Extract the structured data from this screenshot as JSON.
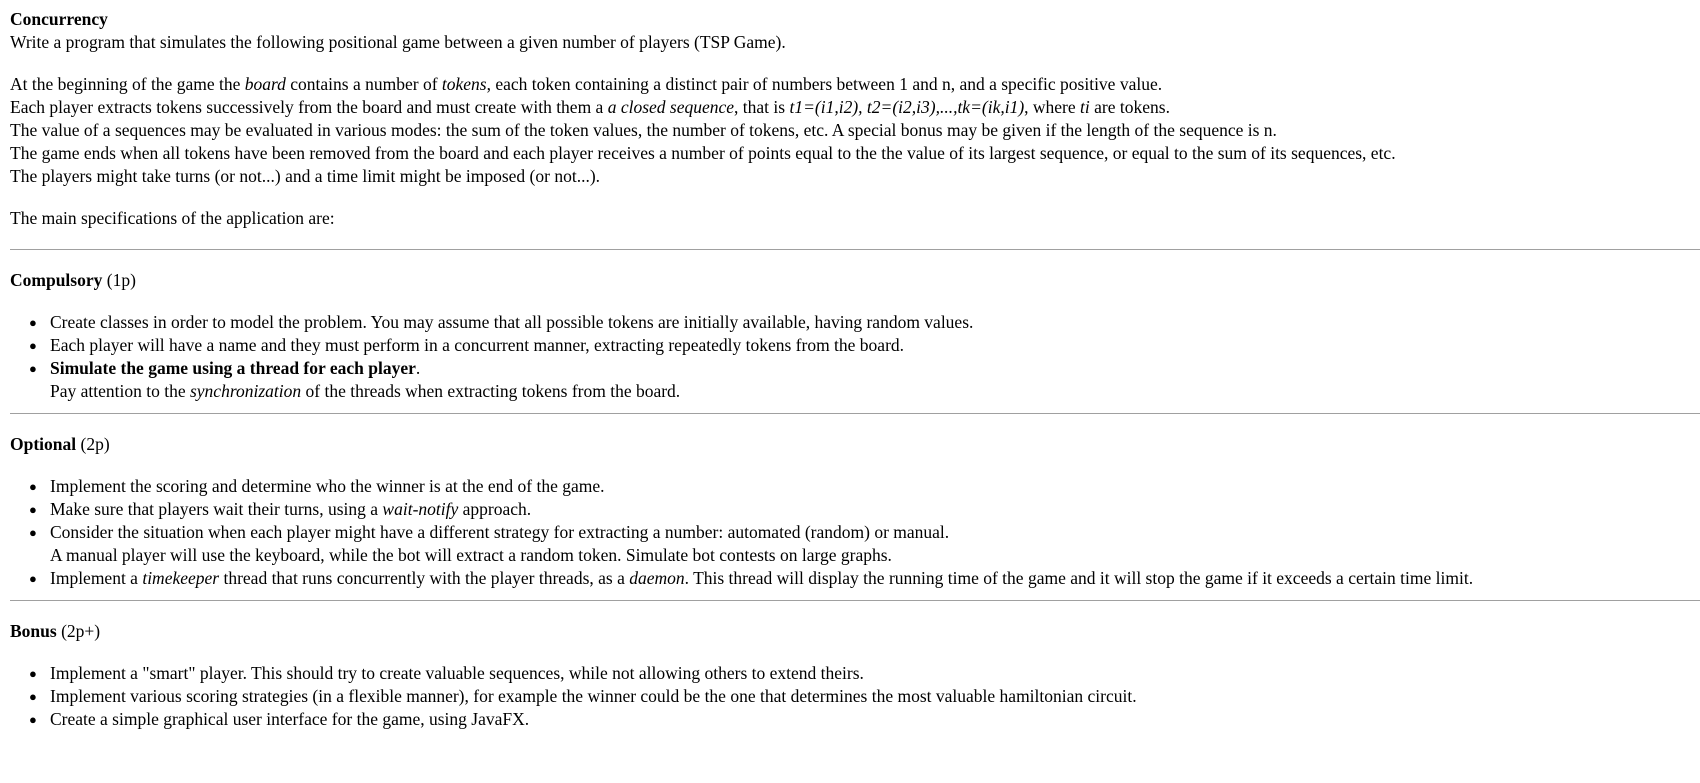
{
  "title": "Concurrency",
  "intro": {
    "line1": "Write a program that simulates the following positional game between a given number of players (TSP Game).",
    "p1_a": "At the beginning of the game the ",
    "p1_board": "board",
    "p1_b": " contains a number of ",
    "p1_tokens": "tokens",
    "p1_c": ", each token containing a distinct pair of numbers between 1 and n, and a specific positive value.",
    "p2_a": "Each player extracts tokens successively from the board and must create with them a ",
    "p2_seq": "a closed sequence",
    "p2_b": ", that is ",
    "p2_formula": "t1=(i1,i2), t2=(i2,i3),...,tk=(ik,i1)",
    "p2_c": ", where ",
    "p2_ti": "ti",
    "p2_d": " are tokens.",
    "p3": "The value of a sequences may be evaluated in various modes: the sum of the token values, the number of tokens, etc. A special bonus may be given if the length of the sequence is n.",
    "p4": "The game ends when all tokens have been removed from the board and each player receives a number of points equal to the the value of its largest sequence, or equal to the sum of its sequences, etc.",
    "p5": "The players might take turns (or not...) and a time limit might be imposed (or not...).",
    "specs": "The main specifications of the application are:"
  },
  "compulsory": {
    "title": "Compulsory",
    "points": " (1p)",
    "item1": "Create classes in order to model the problem. You may assume that all possible tokens are initially available, having random values.",
    "item2": "Each player will have a name and they must perform in a concurrent manner, extracting repeatedly tokens from the board.",
    "item3_bold": "Simulate the game using a thread for each player",
    "item3_dot": ".",
    "item3_b": "Pay attention to the ",
    "item3_sync": "synchronization",
    "item3_c": " of the threads when extracting tokens from the board."
  },
  "optional": {
    "title": "Optional",
    "points": " (2p)",
    "item1": "Implement the scoring and determine who the winner is at the end of the game.",
    "item2_a": "Make sure that players wait their turns, using a ",
    "item2_wn": "wait-notify",
    "item2_b": " approach.",
    "item3_a": "Consider the situation when each player might have a different strategy for extracting a number: automated (random) or manual.",
    "item3_b": "A manual player will use the keyboard, while the bot will extract a random token. Simulate bot contests on large graphs.",
    "item4_a": "Implement a ",
    "item4_tk": "timekeeper",
    "item4_b": " thread that runs concurrently with the player threads, as a ",
    "item4_daemon": "daemon",
    "item4_c": ". This thread will display the running time of the game and it will stop the game if it exceeds a certain time limit."
  },
  "bonus": {
    "title": "Bonus",
    "points": " (2p+)",
    "item1": "Implement a \"smart\" player. This should try to create valuable sequences, while not allowing others to extend theirs.",
    "item2": "Implement various scoring strategies (in a flexible manner), for example the winner could be the one that determines the most valuable hamiltonian circuit.",
    "item3": "Create a simple graphical user interface for the game, using JavaFX."
  },
  "icons": {
    "bullet": "bullet-dot-icon"
  }
}
